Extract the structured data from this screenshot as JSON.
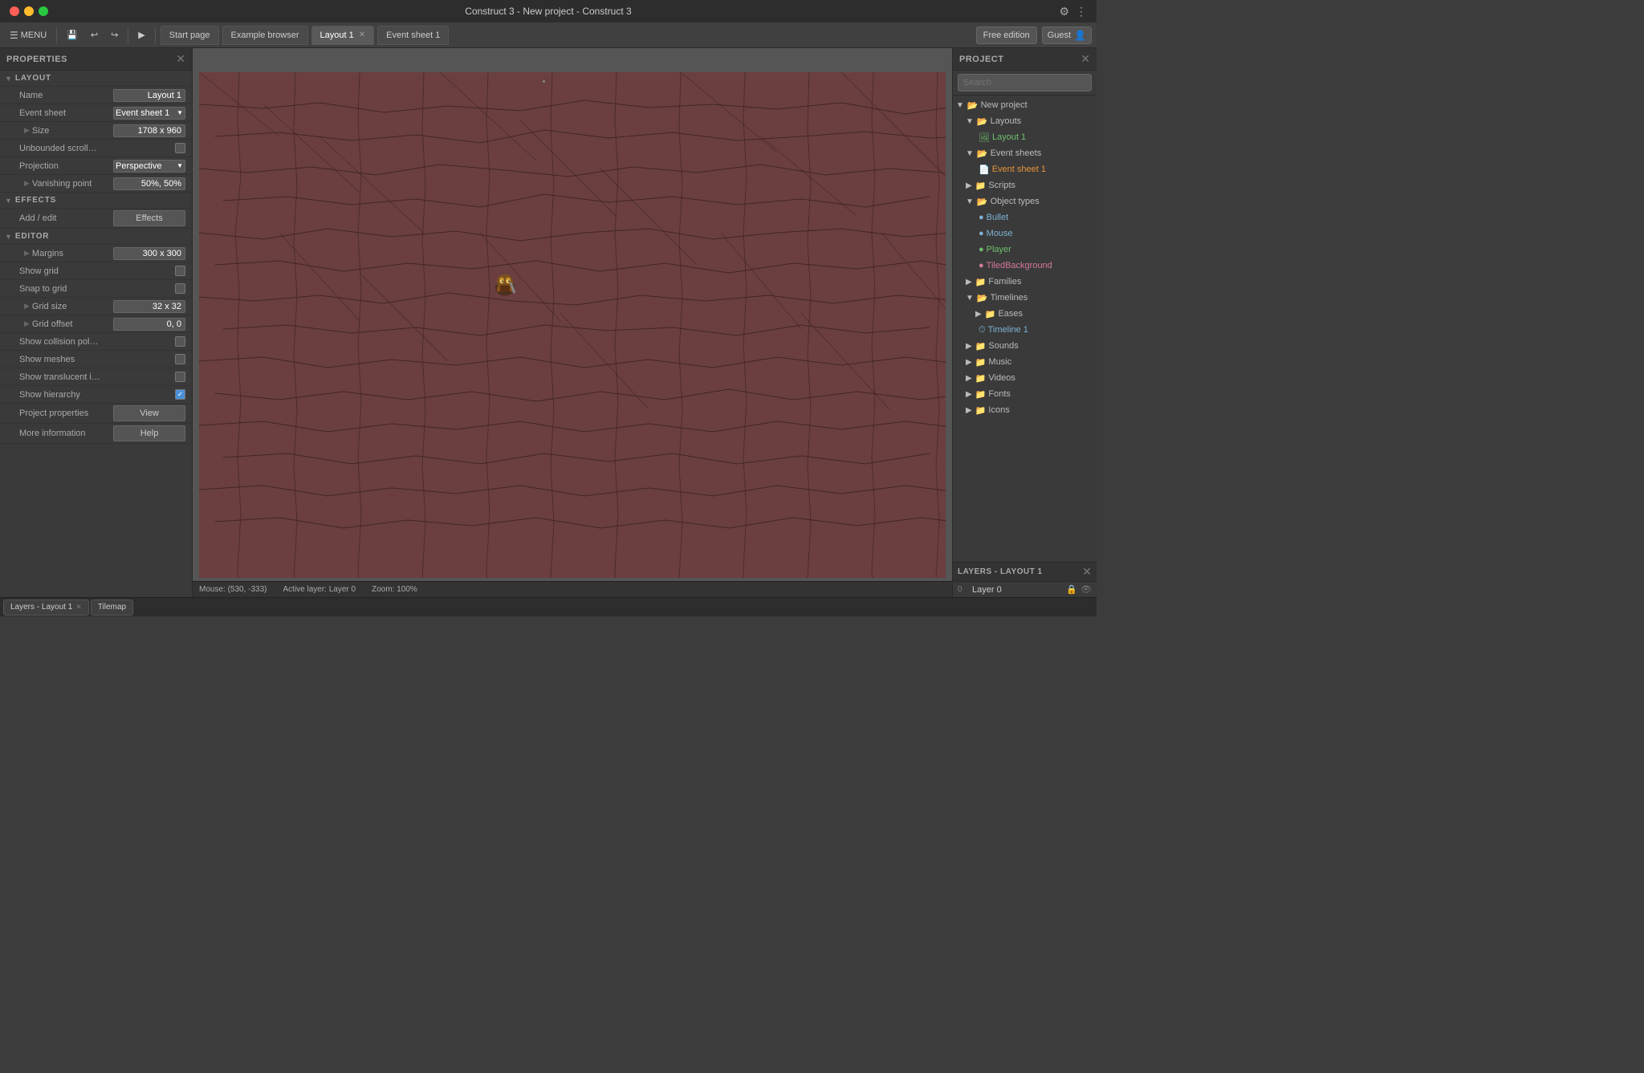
{
  "titleBar": {
    "title": "Construct 3 - New project - Construct 3",
    "settingsIcon": "⚙",
    "moreIcon": "⋮"
  },
  "toolbar": {
    "menuLabel": "MENU",
    "saveIcon": "💾",
    "undoIcon": "↩",
    "redoIcon": "↪",
    "playIcon": "▶",
    "tabs": [
      {
        "label": "Start page",
        "active": false,
        "closable": false
      },
      {
        "label": "Example browser",
        "active": false,
        "closable": false
      },
      {
        "label": "Layout 1",
        "active": true,
        "closable": true
      },
      {
        "label": "Event sheet 1",
        "active": false,
        "closable": false
      }
    ],
    "freeEditionLabel": "Free edition",
    "guestLabel": "Guest"
  },
  "properties": {
    "panelTitle": "PROPERTIES",
    "sections": {
      "layout": {
        "title": "LAYOUT",
        "name": {
          "label": "Name",
          "value": "Layout 1"
        },
        "eventSheet": {
          "label": "Event sheet",
          "value": "Event sheet 1"
        },
        "size": {
          "label": "Size",
          "value": "1708 x 960"
        },
        "unboundedScroll": {
          "label": "Unbounded scroll…",
          "checked": false
        },
        "projection": {
          "label": "Projection",
          "value": "Perspective"
        },
        "vanishingPoint": {
          "label": "Vanishing point",
          "value": "50%, 50%"
        }
      },
      "effects": {
        "title": "EFFECTS",
        "addEditLabel": "Add / edit",
        "effectsLabel": "Effects"
      },
      "editor": {
        "title": "EDITOR",
        "margins": {
          "label": "Margins",
          "value": "300 x 300"
        },
        "showGrid": {
          "label": "Show grid",
          "checked": false
        },
        "snapToGrid": {
          "label": "Snap to grid",
          "checked": false
        },
        "gridSize": {
          "label": "Grid size",
          "value": "32 x 32"
        },
        "gridOffset": {
          "label": "Grid offset",
          "value": "0, 0"
        },
        "showCollision": {
          "label": "Show collision pol…",
          "checked": false
        },
        "showMeshes": {
          "label": "Show meshes",
          "checked": false
        },
        "showTranslucent": {
          "label": "Show translucent i…",
          "checked": false
        },
        "showHierarchy": {
          "label": "Show hierarchy",
          "checked": true
        },
        "projectProperties": {
          "label": "Project properties",
          "btnLabel": "View"
        },
        "moreInfo": {
          "label": "More information",
          "btnLabel": "Help"
        }
      }
    }
  },
  "project": {
    "panelTitle": "PROJECT",
    "searchPlaceholder": "Search",
    "tree": [
      {
        "label": "New project",
        "indent": 0,
        "type": "folder",
        "expanded": true
      },
      {
        "label": "Layouts",
        "indent": 1,
        "type": "folder",
        "expanded": true
      },
      {
        "label": "Layout 1",
        "indent": 2,
        "type": "layout",
        "color": "green"
      },
      {
        "label": "Event sheets",
        "indent": 1,
        "type": "folder",
        "expanded": true
      },
      {
        "label": "Event sheet 1",
        "indent": 2,
        "type": "eventsheet",
        "color": "orange"
      },
      {
        "label": "Scripts",
        "indent": 1,
        "type": "folder",
        "expanded": false
      },
      {
        "label": "Object types",
        "indent": 1,
        "type": "folder",
        "expanded": true
      },
      {
        "label": "Bullet",
        "indent": 2,
        "type": "object",
        "color": "blue"
      },
      {
        "label": "Mouse",
        "indent": 2,
        "type": "object",
        "color": "blue"
      },
      {
        "label": "Player",
        "indent": 2,
        "type": "object",
        "color": "green"
      },
      {
        "label": "TiledBackground",
        "indent": 2,
        "type": "object",
        "color": "pink"
      },
      {
        "label": "Families",
        "indent": 1,
        "type": "folder",
        "expanded": false
      },
      {
        "label": "Timelines",
        "indent": 1,
        "type": "folder",
        "expanded": true
      },
      {
        "label": "Eases",
        "indent": 2,
        "type": "folder",
        "expanded": false
      },
      {
        "label": "Timeline 1",
        "indent": 2,
        "type": "timeline",
        "color": "blue"
      },
      {
        "label": "Sounds",
        "indent": 1,
        "type": "folder",
        "expanded": false
      },
      {
        "label": "Music",
        "indent": 1,
        "type": "folder",
        "expanded": false
      },
      {
        "label": "Videos",
        "indent": 1,
        "type": "folder",
        "expanded": false
      },
      {
        "label": "Fonts",
        "indent": 1,
        "type": "folder",
        "expanded": false
      },
      {
        "label": "Icons",
        "indent": 1,
        "type": "folder",
        "expanded": false
      }
    ]
  },
  "layers": {
    "panelTitle": "LAYERS - LAYOUT 1",
    "items": [
      {
        "num": "0",
        "name": "Layer 0"
      }
    ]
  },
  "bottomTabs": [
    {
      "label": "Layers - Layout 1",
      "active": true
    },
    {
      "label": "Tilemap",
      "active": false
    }
  ],
  "statusBar": {
    "mouse": "Mouse: (530, -333)",
    "activeLayer": "Active layer: Layer 0",
    "zoom": "Zoom: 100%"
  }
}
